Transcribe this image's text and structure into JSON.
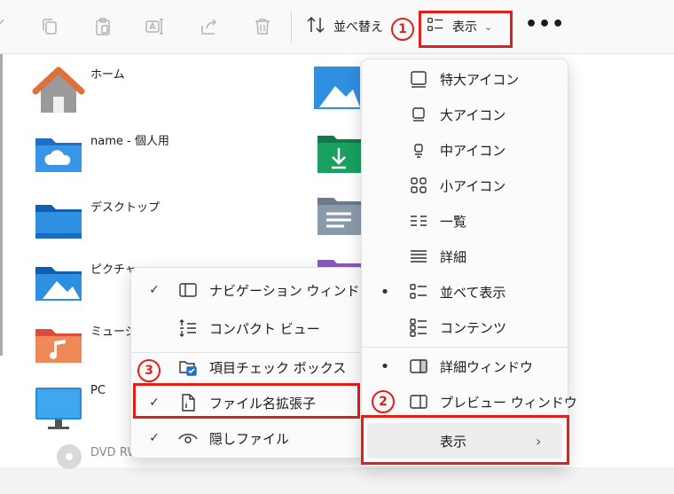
{
  "toolbar": {
    "sort_label": "並べ替え",
    "view_label": "表示",
    "more_label": "•••"
  },
  "annotations": {
    "n1": "1",
    "n2": "2",
    "n3": "3",
    "color": "#e0201c"
  },
  "files_left": [
    {
      "name": "ホーム",
      "icon": "home-folder-icon"
    },
    {
      "name": "name - 個人用",
      "icon": "onedrive-folder-icon"
    },
    {
      "name": "デスクトップ",
      "icon": "desktop-folder-icon"
    },
    {
      "name": "ピクチャ",
      "icon": "pictures-folder-icon"
    },
    {
      "name": "ミュージック",
      "icon": "music-folder-icon"
    },
    {
      "name": "PC",
      "icon": "pc-icon"
    },
    {
      "name": "DVD RW ドライブ",
      "icon": "dvd-drive-icon"
    }
  ],
  "view_menu": {
    "items": [
      {
        "label": "特大アイコン",
        "icon": "extra-large-icons-icon",
        "selected": false
      },
      {
        "label": "大アイコン",
        "icon": "large-icons-icon",
        "selected": false
      },
      {
        "label": "中アイコン",
        "icon": "medium-icons-icon",
        "selected": false
      },
      {
        "label": "小アイコン",
        "icon": "small-icons-icon",
        "selected": false
      },
      {
        "label": "一覧",
        "icon": "list-icon",
        "selected": false
      },
      {
        "label": "詳細",
        "icon": "details-icon",
        "selected": false
      },
      {
        "label": "並べて表示",
        "icon": "tiles-icon",
        "selected": true
      },
      {
        "label": "コンテンツ",
        "icon": "content-icon",
        "selected": false
      },
      {
        "label": "詳細ウィンドウ",
        "icon": "details-pane-icon",
        "selected": true
      },
      {
        "label": "プレビュー ウィンドウ",
        "icon": "preview-pane-icon",
        "selected": false
      },
      {
        "label": "表示",
        "icon": "chevron-right-icon",
        "submenu": true
      }
    ]
  },
  "show_submenu": {
    "items": [
      {
        "label": "ナビゲーション ウィンドウ",
        "icon": "navigation-pane-icon",
        "checked": true
      },
      {
        "label": "コンパクト ビュー",
        "icon": "compact-view-icon",
        "checked": false
      },
      {
        "label": "項目チェック ボックス",
        "icon": "item-checkbox-icon",
        "checked": false
      },
      {
        "label": "ファイル名拡張子",
        "icon": "file-extension-icon",
        "checked": true
      },
      {
        "label": "隠しファイル",
        "icon": "hidden-items-icon",
        "checked": true
      }
    ],
    "check_glyph": "✓",
    "bullet_glyph": "•"
  }
}
